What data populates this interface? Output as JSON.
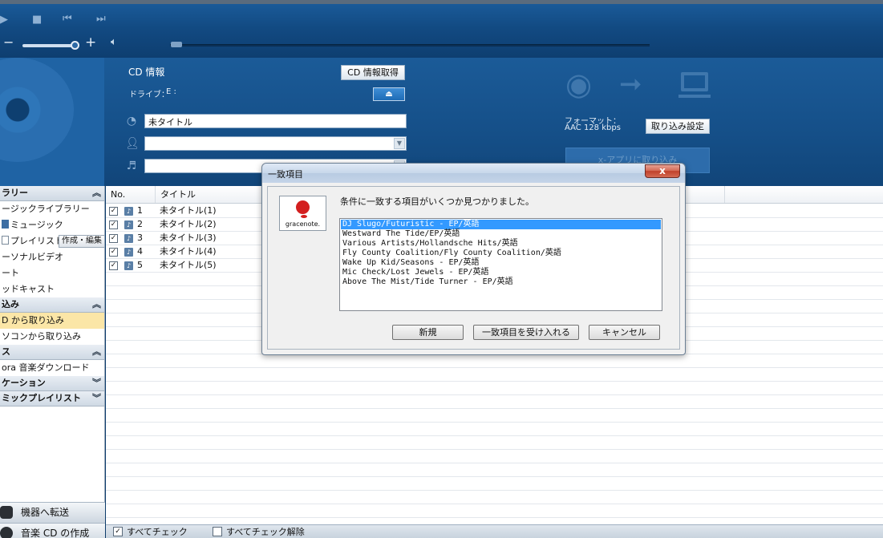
{
  "player": {
    "play_icon": "play-icon",
    "stop_icon": "stop-icon",
    "prev_icon": "prev-icon",
    "next_icon": "next-icon",
    "vol_minus": "−",
    "vol_plus": "+",
    "volume_level": 0.88
  },
  "cd_info": {
    "heading": "CD 情報",
    "drive_label": "ドライブ：",
    "drive_value": "E :",
    "fetch_button": "CD 情報取得",
    "eject_symbol": "⏏",
    "title_value": "未タイトル",
    "artist_value": "",
    "genre_value": "",
    "format_label": "フォーマット：",
    "format_value": "AAC 128 kbps",
    "import_settings_button": "取り込み設定",
    "import_button": "x-アプリに取り込み"
  },
  "sidebar": {
    "sections": [
      {
        "label": "ラリー",
        "chev": "︽"
      },
      {
        "label": "込み",
        "chev": "︽"
      },
      {
        "label": "ス",
        "chev": "︽"
      },
      {
        "label": "ケーション",
        "chev": "︾"
      },
      {
        "label": "ミックプレイリスト",
        "chev": "︾"
      }
    ],
    "items": [
      {
        "label": "ージックライブラリー"
      },
      {
        "label": "ミュージック"
      },
      {
        "label": "プレイリスト"
      },
      {
        "label": "ーソナルビデオ"
      },
      {
        "label": "ート"
      },
      {
        "label": "ッドキャスト"
      },
      {
        "label": "D から取り込み"
      },
      {
        "label": "ソコンから取り込み"
      },
      {
        "label": "ora 音楽ダウンロード"
      }
    ],
    "edit_button": "作成・編集",
    "transfer_label": "機器へ転送",
    "create_cd_label": "音楽 CD の作成"
  },
  "tracklist": {
    "columns": [
      "No.",
      "タイトル"
    ],
    "rows": [
      {
        "no": "1",
        "title": "未タイトル(1)",
        "checked": "✓"
      },
      {
        "no": "2",
        "title": "未タイトル(2)",
        "checked": "✓"
      },
      {
        "no": "3",
        "title": "未タイトル(3)",
        "checked": "✓"
      },
      {
        "no": "4",
        "title": "未タイトル(4)",
        "checked": "✓"
      },
      {
        "no": "5",
        "title": "未タイトル(5)",
        "checked": "✓"
      }
    ],
    "check_all": "すべてチェック",
    "uncheck_all": "すべてチェック解除"
  },
  "dialog": {
    "title": "一致項目",
    "close": "x",
    "logo_word": "gracenote.",
    "message": "条件に一致する項目がいくつか見つかりました。",
    "matches": [
      "DJ Slugo/Futuristic - EP/英語",
      "Westward The Tide/EP/英語",
      "Various Artists/Hollandsche Hits/英語",
      "Fly County Coalition/Fly County Coalition/英語",
      "Wake Up Kid/Seasons - EP/英語",
      "Mic Check/Lost Jewels - EP/英語",
      "Above The Mist/Tide Turner - EP/英語"
    ],
    "new_button": "新規",
    "accept_button": "一致項目を受け入れる",
    "cancel_button": "キャンセル"
  }
}
